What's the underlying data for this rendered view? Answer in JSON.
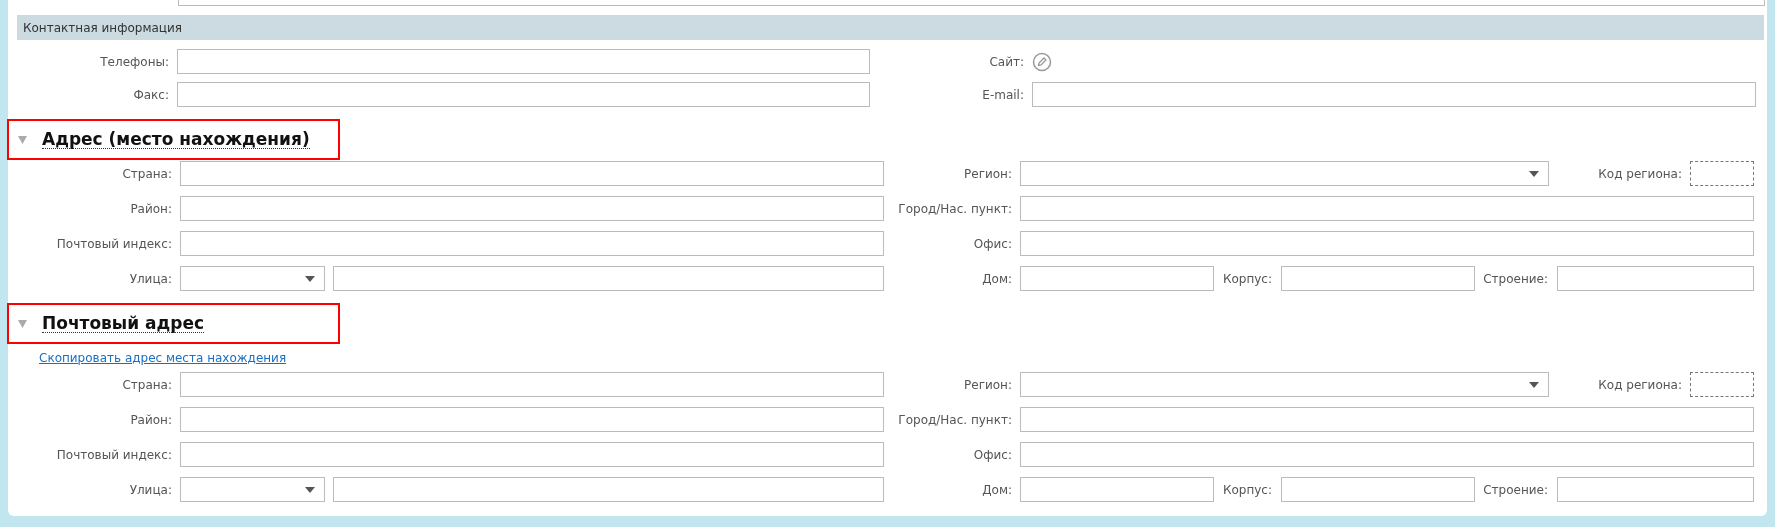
{
  "contact_section": {
    "title": "Контактная информация",
    "fields": [
      {
        "label": "Телефоны:",
        "kind": "input"
      },
      {
        "label": "Сайт:",
        "kind": "edit-link"
      },
      {
        "label": "Факс:",
        "kind": "input"
      },
      {
        "label": "E-mail:",
        "kind": "input"
      }
    ]
  },
  "address_sections": [
    {
      "title": "Адрес (место нахождения)",
      "expanded": true,
      "highlighted": true,
      "labels": {
        "country": "Страна:",
        "region": "Регион:",
        "region_code": "Код региона:",
        "district": "Район:",
        "city": "Город/Нас. пункт:",
        "postcode": "Почтовый индекс:",
        "office": "Офис:",
        "street": "Улица:",
        "house": "Дом:",
        "block": "Корпус:",
        "building": "Строение:"
      }
    },
    {
      "title": "Почтовый адрес",
      "expanded": true,
      "highlighted": true,
      "copy_link": "Скопировать адрес места нахождения",
      "labels": {
        "country": "Страна:",
        "region": "Регион:",
        "region_code": "Код региона:",
        "district": "Район:",
        "city": "Город/Нас. пункт:",
        "postcode": "Почтовый индекс:",
        "office": "Офис:",
        "street": "Улица:",
        "house": "Дом:",
        "block": "Корпус:",
        "building": "Строение:"
      }
    }
  ]
}
